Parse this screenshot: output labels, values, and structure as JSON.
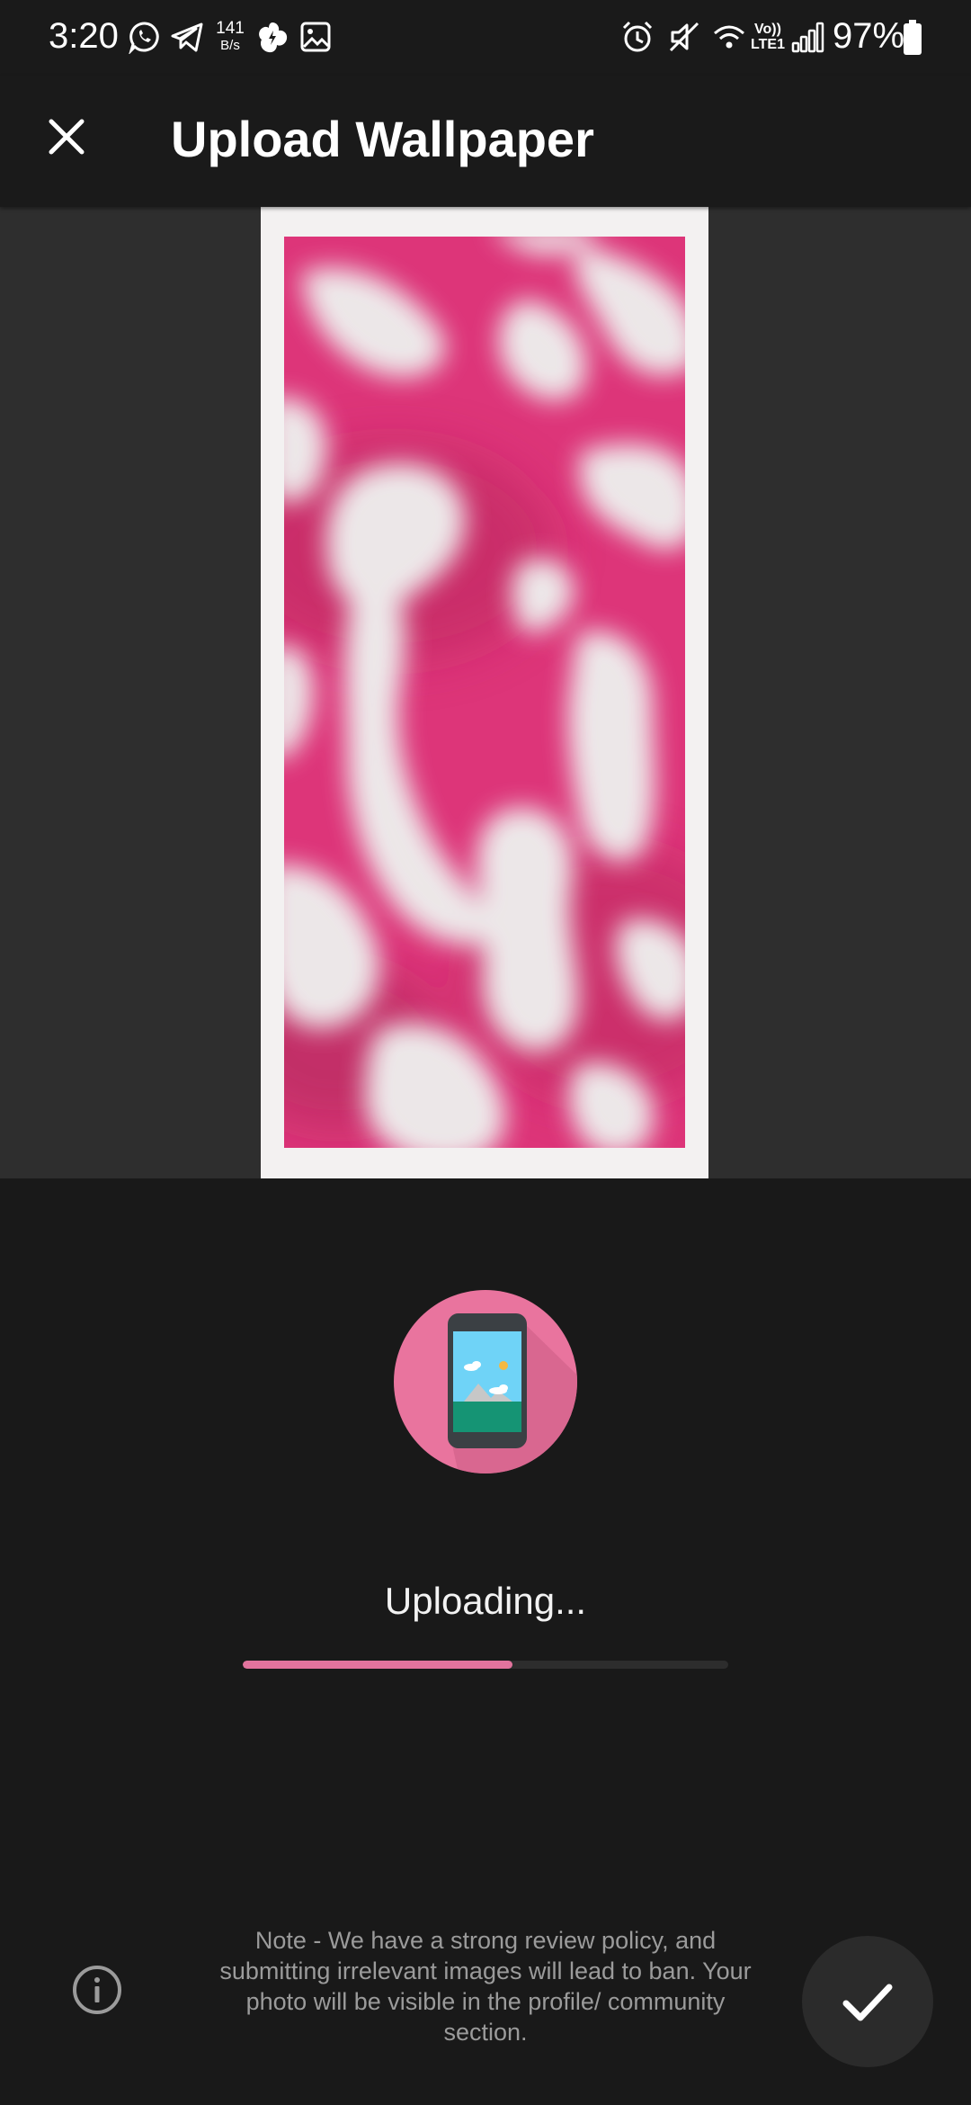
{
  "status_bar": {
    "time": "3:20",
    "net_speed_value": "141",
    "net_speed_unit": "B/s",
    "volte_top": "Vo))",
    "volte_bottom": "LTE1",
    "battery": "97%",
    "icons": [
      "whatsapp-icon",
      "telegram-icon",
      "net-speed",
      "fan-icon",
      "gallery-icon",
      "alarm-icon",
      "mute-icon",
      "wifi-icon",
      "volte-icon",
      "signal-icon",
      "battery-icon"
    ]
  },
  "app_bar": {
    "title": "Upload Wallpaper",
    "close_icon": "close-icon"
  },
  "upload": {
    "illustration_icon": "phone-image-icon",
    "status": "Uploading...",
    "progress": 0.555
  },
  "footer": {
    "info_icon": "info-icon",
    "note": "Note - We have a strong review policy, and submitting irrelevant images will lead to ban. Your photo will be visible in the profile/ community section.",
    "confirm_icon": "check-icon"
  },
  "colors": {
    "background": "#191919",
    "accent": "#e2739d",
    "wallpaper_pink": "#dc2d74",
    "wallpaper_light": "#ece7e8"
  }
}
